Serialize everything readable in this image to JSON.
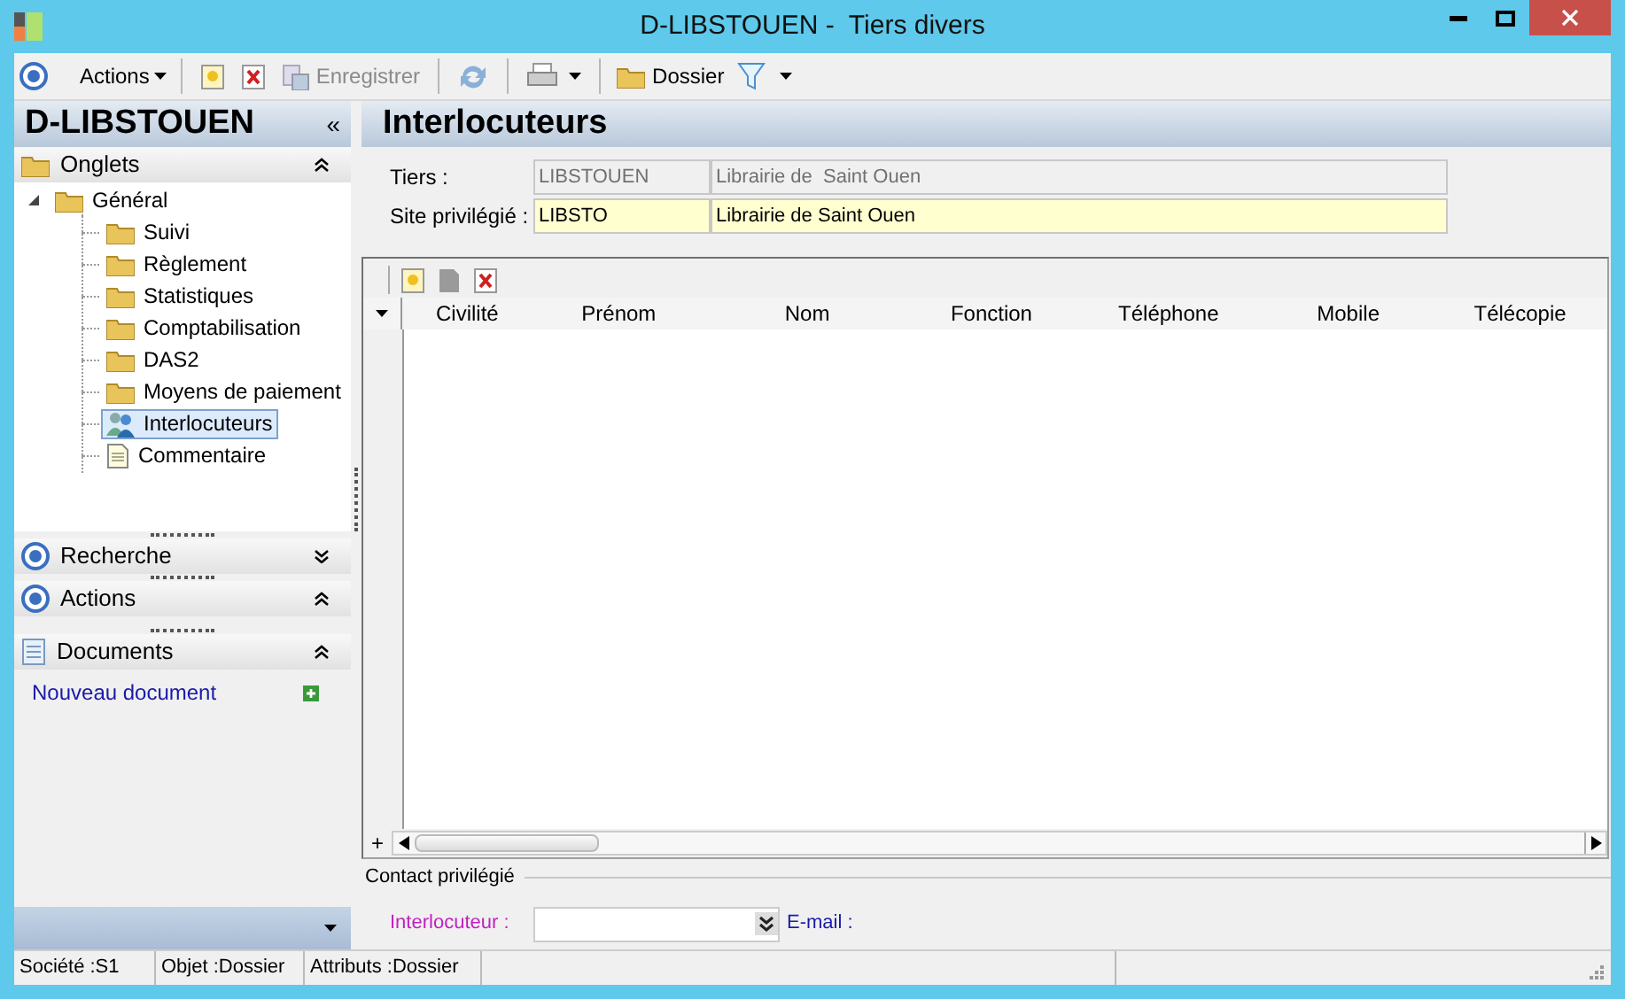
{
  "window": {
    "title": "D-LIBSTOUEN -  Tiers divers"
  },
  "toolbar": [
    {
      "kind": "circle"
    },
    {
      "kind": "menu",
      "label": "Actions"
    },
    {
      "kind": "new"
    },
    {
      "kind": "delete"
    },
    {
      "kind": "save",
      "label": "Enregistrer",
      "disabled": true
    },
    {
      "kind": "refresh"
    },
    {
      "kind": "print"
    },
    {
      "kind": "folder",
      "label": "Dossier"
    },
    {
      "kind": "filter"
    }
  ],
  "sidebar": {
    "title": "D-LIBSTOUEN",
    "collapse_mark": "«",
    "onglets": {
      "label": "Onglets",
      "expanded": true
    },
    "tree": [
      {
        "label": "Général",
        "kind": "folder",
        "expanded": true,
        "selected": false,
        "children": [
          {
            "label": "Suivi",
            "kind": "folder",
            "selected": false
          },
          {
            "label": "Règlement",
            "kind": "folder",
            "selected": false
          },
          {
            "label": "Statistiques",
            "kind": "folder",
            "selected": false
          },
          {
            "label": "Comptabilisation",
            "kind": "folder",
            "selected": false
          },
          {
            "label": "DAS2",
            "kind": "folder",
            "selected": false
          },
          {
            "label": "Moyens de paiement",
            "kind": "folder",
            "selected": false
          },
          {
            "label": "Interlocuteurs",
            "kind": "people",
            "selected": true
          },
          {
            "label": "Commentaire",
            "kind": "note",
            "selected": false
          }
        ]
      }
    ],
    "sections": [
      {
        "label": "Recherche",
        "kind": "circle",
        "expanded": false
      },
      {
        "label": "Actions",
        "kind": "circle",
        "expanded": true
      },
      {
        "label": "Documents",
        "kind": "doc",
        "expanded": true
      }
    ],
    "documents_link": "Nouveau document"
  },
  "page": {
    "title": "Interlocuteurs",
    "fields": [
      {
        "label": "Tiers :",
        "code": "LIBSTOUEN",
        "name": "Librairie de  Saint Ouen",
        "kind": "readonly"
      },
      {
        "label": "Site privilégié :",
        "code": "LIBSTO",
        "name": "Librairie de Saint Ouen",
        "kind": "editable"
      }
    ],
    "grid": {
      "columns": [
        "Civilité",
        "Prénom",
        "Nom",
        "Fonction",
        "Téléphone",
        "Mobile",
        "Télécopie"
      ],
      "add_mark": "+"
    },
    "contact": {
      "title": "Contact privilégié",
      "interlocuteur_label": "Interlocuteur :",
      "email_label": "E-mail :"
    }
  },
  "status_bar": [
    "Société :S1",
    "Objet :Dossier",
    "Attributs :Dossier"
  ]
}
